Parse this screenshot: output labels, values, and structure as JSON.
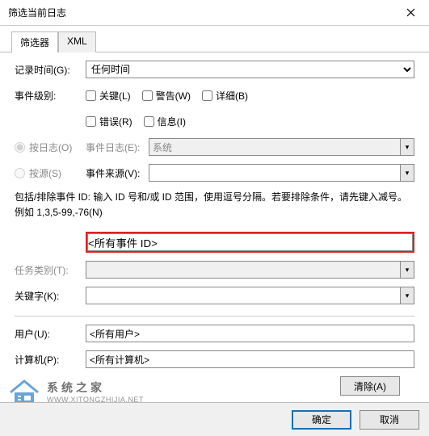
{
  "window_title": "筛选当前日志",
  "tabs": {
    "filter": "筛选器",
    "xml": "XML"
  },
  "time": {
    "label": "记录时间(G):",
    "value": "任何时间"
  },
  "level": {
    "label": "事件级别:",
    "critical": "关键(L)",
    "warning": "警告(W)",
    "verbose": "详细(B)",
    "error": "错误(R)",
    "info": "信息(I)"
  },
  "source_mode": {
    "by_log": "按日志(O)",
    "by_source": "按源(S)",
    "event_log_label": "事件日志(E):",
    "event_log_value": "系统",
    "event_source_label": "事件来源(V):"
  },
  "desc": "包括/排除事件 ID: 输入 ID 号和/或 ID 范围，使用逗号分隔。若要排除条件，请先键入减号。例如 1,3,5-99,-76(N)",
  "eventid_placeholder": "<所有事件 ID>",
  "task": {
    "label": "任务类别(T):"
  },
  "keywords": {
    "label": "关键字(K):"
  },
  "user": {
    "label": "用户(U):",
    "value": "<所有用户>"
  },
  "computer": {
    "label": "计算机(P):",
    "value": "<所有计算机>"
  },
  "clear": "清除(A)",
  "ok": "确定",
  "cancel": "取消",
  "wm": {
    "l1": "系统之家",
    "l2": "WWW.XITONGZHIJIA.NET"
  }
}
